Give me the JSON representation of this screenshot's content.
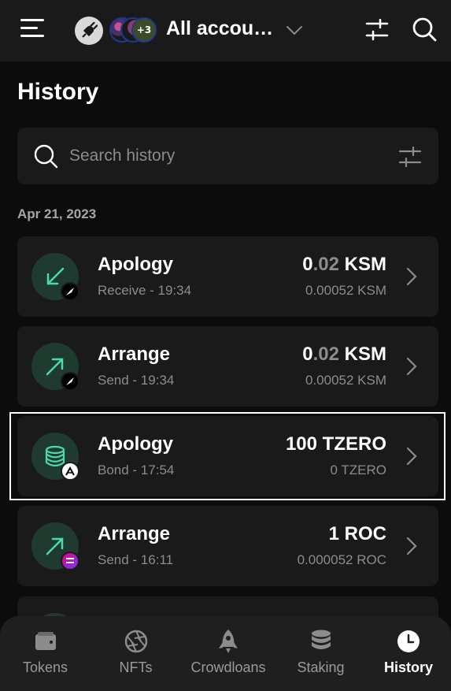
{
  "header": {
    "account_label": "All accou…",
    "extra_accounts": "+3"
  },
  "page": {
    "title": "History"
  },
  "search": {
    "placeholder": "Search history",
    "value": ""
  },
  "groups": [
    {
      "date": "Apr 21, 2023",
      "items": [
        {
          "name": "Apology",
          "subtitle": "Receive - 19:34",
          "amount_int": "0",
          "amount_dec": ".02",
          "amount_unit": "KSM",
          "fee": "0.00052 KSM",
          "icon": "receive-arrow-icon",
          "network_icon": "kusama-icon"
        },
        {
          "name": "Arrange",
          "subtitle": "Send - 19:34",
          "amount_int": "0",
          "amount_dec": ".02",
          "amount_unit": "KSM",
          "fee": "0.00052 KSM",
          "icon": "send-arrow-icon",
          "network_icon": "kusama-icon"
        },
        {
          "name": "Apology",
          "subtitle": "Bond - 17:54",
          "amount_int": "100",
          "amount_dec": "",
          "amount_unit": "TZERO",
          "fee": "0 TZERO",
          "icon": "database-icon",
          "network_icon": "aleph-zero-icon"
        },
        {
          "name": "Arrange",
          "subtitle": "Send - 16:11",
          "amount_int": "1",
          "amount_dec": "",
          "amount_unit": "ROC",
          "fee": "0.000052 ROC",
          "icon": "send-arrow-icon",
          "network_icon": "rococo-icon"
        }
      ]
    }
  ],
  "tabs": [
    {
      "label": "Tokens",
      "icon": "wallet-icon",
      "active": false
    },
    {
      "label": "NFTs",
      "icon": "aperture-icon",
      "active": false
    },
    {
      "label": "Crowdloans",
      "icon": "rocket-icon",
      "active": false
    },
    {
      "label": "Staking",
      "icon": "database-icon",
      "active": false
    },
    {
      "label": "History",
      "icon": "clock-icon",
      "active": true
    }
  ],
  "colors": {
    "accent_green": "#4cd9ac",
    "background": "#0c0c0c",
    "card": "#1a1a1a"
  }
}
